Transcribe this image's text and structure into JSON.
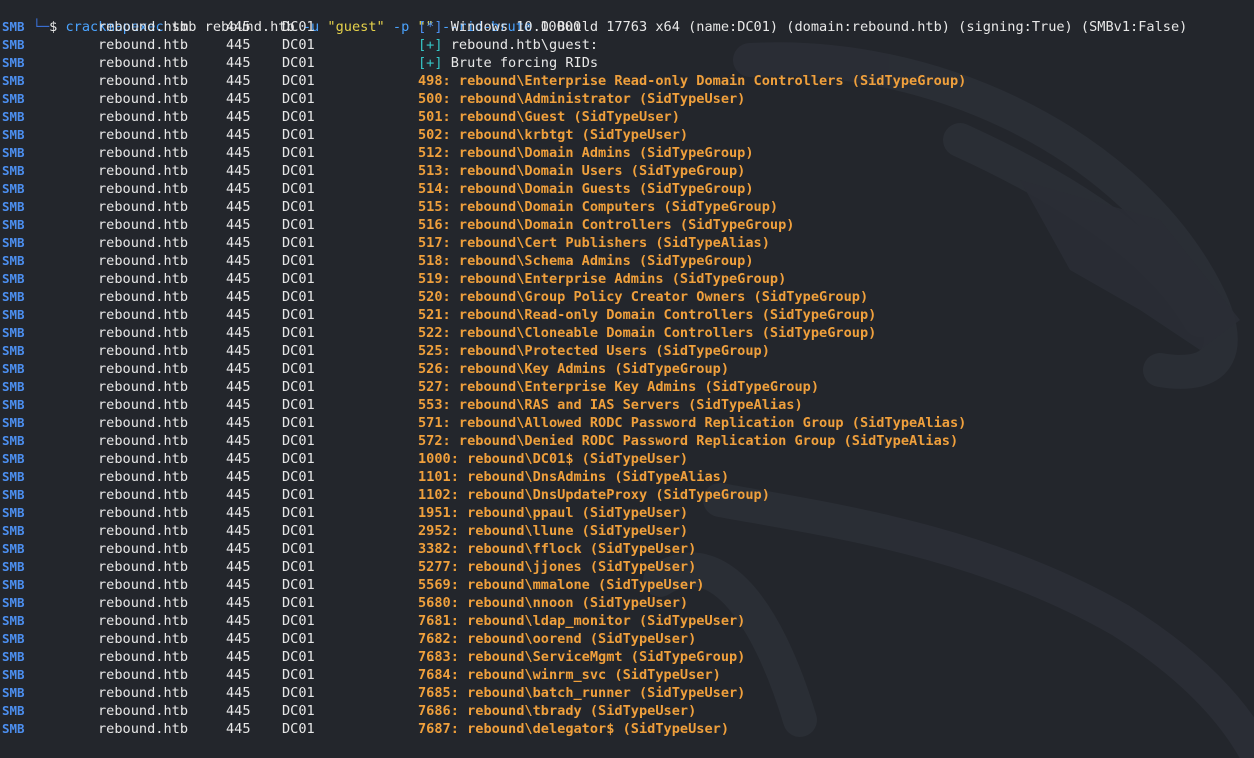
{
  "prompt": {
    "corner": "└─",
    "dollar": "$",
    "command": "crackmapexec",
    "args": [
      {
        "t": "plain",
        "v": " smb rebound.htb "
      },
      {
        "t": "opt",
        "v": "-u"
      },
      {
        "t": "plain",
        "v": " "
      },
      {
        "t": "str",
        "v": "\"guest\""
      },
      {
        "t": "plain",
        "v": " "
      },
      {
        "t": "opt",
        "v": "-p"
      },
      {
        "t": "plain",
        "v": " "
      },
      {
        "t": "str",
        "v": "\"\""
      },
      {
        "t": "plain",
        "v": " "
      },
      {
        "t": "opt",
        "v": "--rid-brute"
      },
      {
        "t": "plain",
        "v": " 10000"
      }
    ]
  },
  "columns": {
    "proto": "SMB",
    "host": "rebound.htb",
    "port": "445",
    "name": "DC01"
  },
  "info_lines": [
    {
      "tag": "[*]",
      "tag_type": "star",
      "text": " Windows 10.0 Build 17763 x64 (name:DC01) (domain:rebound.htb) (signing:True) (SMBv1:False)"
    },
    {
      "tag": "[+]",
      "tag_type": "plus",
      "text": " rebound.htb\\guest:"
    },
    {
      "tag": "[+]",
      "tag_type": "plus",
      "text": " Brute forcing RIDs"
    }
  ],
  "rid_lines": [
    "498: rebound\\Enterprise Read-only Domain Controllers (SidTypeGroup)",
    "500: rebound\\Administrator (SidTypeUser)",
    "501: rebound\\Guest (SidTypeUser)",
    "502: rebound\\krbtgt (SidTypeUser)",
    "512: rebound\\Domain Admins (SidTypeGroup)",
    "513: rebound\\Domain Users (SidTypeGroup)",
    "514: rebound\\Domain Guests (SidTypeGroup)",
    "515: rebound\\Domain Computers (SidTypeGroup)",
    "516: rebound\\Domain Controllers (SidTypeGroup)",
    "517: rebound\\Cert Publishers (SidTypeAlias)",
    "518: rebound\\Schema Admins (SidTypeGroup)",
    "519: rebound\\Enterprise Admins (SidTypeGroup)",
    "520: rebound\\Group Policy Creator Owners (SidTypeGroup)",
    "521: rebound\\Read-only Domain Controllers (SidTypeGroup)",
    "522: rebound\\Cloneable Domain Controllers (SidTypeGroup)",
    "525: rebound\\Protected Users (SidTypeGroup)",
    "526: rebound\\Key Admins (SidTypeGroup)",
    "527: rebound\\Enterprise Key Admins (SidTypeGroup)",
    "553: rebound\\RAS and IAS Servers (SidTypeAlias)",
    "571: rebound\\Allowed RODC Password Replication Group (SidTypeAlias)",
    "572: rebound\\Denied RODC Password Replication Group (SidTypeAlias)",
    "1000: rebound\\DC01$ (SidTypeUser)",
    "1101: rebound\\DnsAdmins (SidTypeAlias)",
    "1102: rebound\\DnsUpdateProxy (SidTypeGroup)",
    "1951: rebound\\ppaul (SidTypeUser)",
    "2952: rebound\\llune (SidTypeUser)",
    "3382: rebound\\fflock (SidTypeUser)",
    "5277: rebound\\jjones (SidTypeUser)",
    "5569: rebound\\mmalone (SidTypeUser)",
    "5680: rebound\\nnoon (SidTypeUser)",
    "7681: rebound\\ldap_monitor (SidTypeUser)",
    "7682: rebound\\oorend (SidTypeUser)",
    "7683: rebound\\ServiceMgmt (SidTypeGroup)",
    "7684: rebound\\winrm_svc (SidTypeUser)",
    "7685: rebound\\batch_runner (SidTypeUser)",
    "7686: rebound\\tbrady (SidTypeUser)",
    "7687: rebound\\delegator$ (SidTypeUser)"
  ],
  "colors": {
    "background": "#23262c",
    "proto": "#4c8ff0",
    "rid_text": "#f0a03c",
    "tag_star": "#4c8ff0",
    "tag_plus": "#35c6c6",
    "string": "#e6d24a"
  }
}
